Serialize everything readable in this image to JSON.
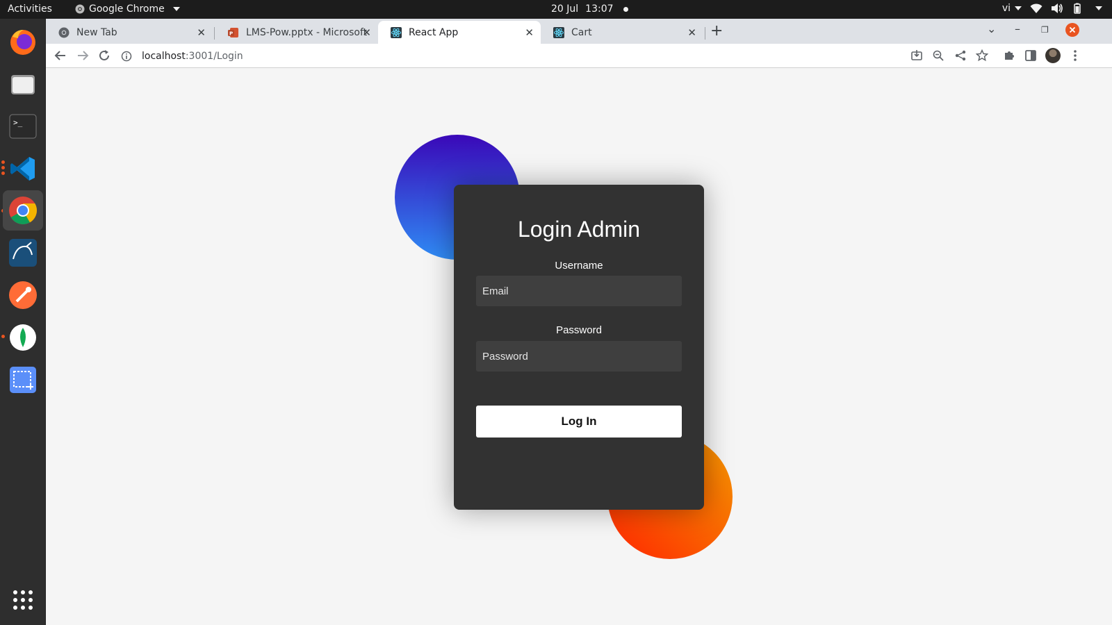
{
  "topbar": {
    "activities": "Activities",
    "app_name": "Google Chrome",
    "date": "20 Jul",
    "time": "13:07",
    "language": "vi"
  },
  "dock": {
    "apps": [
      "firefox-icon",
      "files-icon",
      "terminal-icon",
      "vscode-icon",
      "chrome-icon",
      "mysql-workbench-icon",
      "postman-icon",
      "mongodb-compass-icon",
      "screenshot-icon"
    ],
    "active": "chrome-icon"
  },
  "browser": {
    "tabs": [
      {
        "title": "New Tab",
        "active": false
      },
      {
        "title": "LMS-Pow.pptx - Microsoft",
        "active": false
      },
      {
        "title": "React App",
        "active": true
      },
      {
        "title": "Cart",
        "active": false
      }
    ],
    "url_host": "localhost",
    "url_path": ":3001/Login"
  },
  "login": {
    "title": "Login Admin",
    "username_label": "Username",
    "username_placeholder": "Email",
    "password_label": "Password",
    "password_placeholder": "Password",
    "submit_label": "Log In"
  },
  "colors": {
    "card_bg": "#323232",
    "circle_blue_top": "#3a08b8",
    "circle_blue_bottom": "#2f8cf5",
    "circle_orange_start": "#ff2600",
    "circle_orange_end": "#f59a00"
  }
}
